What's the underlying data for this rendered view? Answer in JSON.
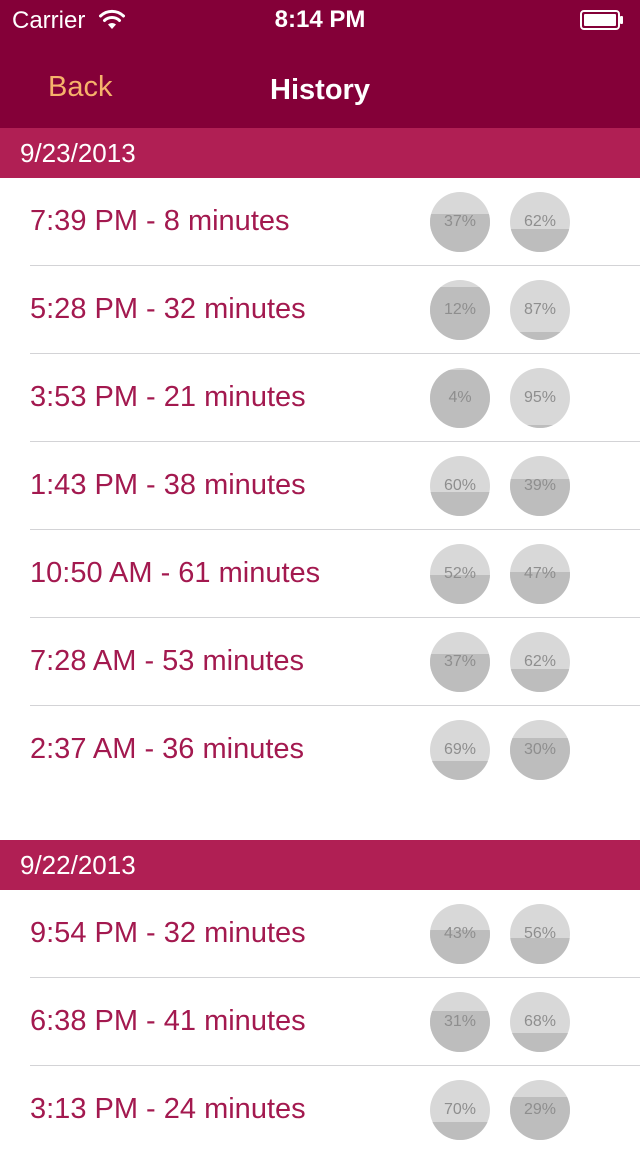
{
  "status_bar": {
    "carrier": "Carrier",
    "time": "8:14 PM"
  },
  "nav": {
    "back_label": "Back",
    "title": "History"
  },
  "colors": {
    "nav_bg": "#840038",
    "section_bg": "#b01f54",
    "text": "#a3194f",
    "back": "#f6b26b"
  },
  "sections": [
    {
      "date": "9/23/2013",
      "rows": [
        {
          "label": "7:39 PM - 8 minutes",
          "pct1": "37%",
          "level1": 0.63,
          "pct2": "62%",
          "level2": 0.38
        },
        {
          "label": "5:28 PM - 32 minutes",
          "pct1": "12%",
          "level1": 0.88,
          "pct2": "87%",
          "level2": 0.13
        },
        {
          "label": "3:53 PM - 21 minutes",
          "pct1": "4%",
          "level1": 0.96,
          "pct2": "95%",
          "level2": 0.05
        },
        {
          "label": "1:43 PM - 38 minutes",
          "pct1": "60%",
          "level1": 0.4,
          "pct2": "39%",
          "level2": 0.61
        },
        {
          "label": "10:50 AM - 61 minutes",
          "pct1": "52%",
          "level1": 0.48,
          "pct2": "47%",
          "level2": 0.53
        },
        {
          "label": "7:28 AM - 53 minutes",
          "pct1": "37%",
          "level1": 0.63,
          "pct2": "62%",
          "level2": 0.38
        },
        {
          "label": "2:37 AM - 36 minutes",
          "pct1": "69%",
          "level1": 0.31,
          "pct2": "30%",
          "level2": 0.7
        }
      ]
    },
    {
      "date": "9/22/2013",
      "rows": [
        {
          "label": "9:54 PM - 32 minutes",
          "pct1": "43%",
          "level1": 0.57,
          "pct2": "56%",
          "level2": 0.44
        },
        {
          "label": "6:38 PM - 41 minutes",
          "pct1": "31%",
          "level1": 0.69,
          "pct2": "68%",
          "level2": 0.32
        },
        {
          "label": "3:13 PM - 24 minutes",
          "pct1": "70%",
          "level1": 0.3,
          "pct2": "29%",
          "level2": 0.71
        }
      ]
    }
  ]
}
